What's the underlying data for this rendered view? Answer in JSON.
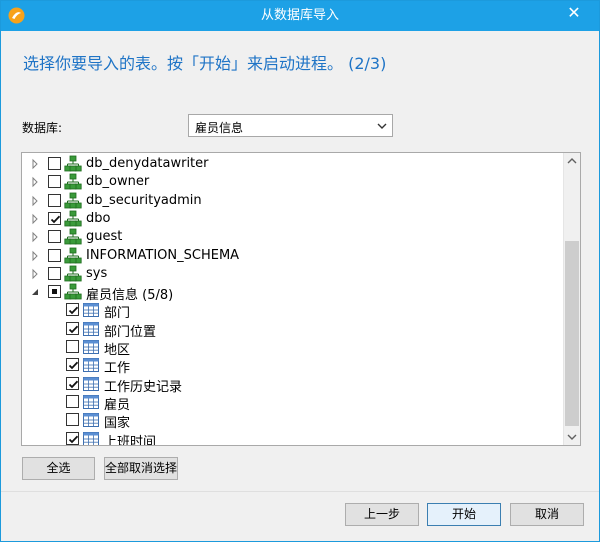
{
  "window": {
    "title": "从数据库导入",
    "accent_color": "#1da1e6",
    "close_symbol": "✕"
  },
  "heading": "选择你要导入的表。按「开始」来启动进程。 (2/3)",
  "database": {
    "label": "数据库:",
    "selected": "雇员信息"
  },
  "tree": {
    "items": [
      {
        "label": "db_denydatawriter",
        "type": "schema",
        "checked": "unchecked",
        "expander": "collapsed"
      },
      {
        "label": "db_owner",
        "type": "schema",
        "checked": "unchecked",
        "expander": "collapsed"
      },
      {
        "label": "db_securityadmin",
        "type": "schema",
        "checked": "unchecked",
        "expander": "collapsed"
      },
      {
        "label": "dbo",
        "type": "schema",
        "checked": "checked",
        "expander": "collapsed"
      },
      {
        "label": "guest",
        "type": "schema",
        "checked": "unchecked",
        "expander": "collapsed"
      },
      {
        "label": "INFORMATION_SCHEMA",
        "type": "schema",
        "checked": "unchecked",
        "expander": "collapsed"
      },
      {
        "label": "sys",
        "type": "schema",
        "checked": "unchecked",
        "expander": "collapsed"
      },
      {
        "label": "雇员信息 (5/8)",
        "type": "schema",
        "checked": "partial",
        "expander": "expanded"
      },
      {
        "label": "部门",
        "type": "table",
        "checked": "checked"
      },
      {
        "label": "部门位置",
        "type": "table",
        "checked": "checked"
      },
      {
        "label": "地区",
        "type": "table",
        "checked": "unchecked"
      },
      {
        "label": "工作",
        "type": "table",
        "checked": "checked"
      },
      {
        "label": "工作历史记录",
        "type": "table",
        "checked": "checked"
      },
      {
        "label": "雇员",
        "type": "table",
        "checked": "unchecked"
      },
      {
        "label": "国家",
        "type": "table",
        "checked": "unchecked"
      },
      {
        "label": "上班时间",
        "type": "table",
        "checked": "checked"
      }
    ]
  },
  "buttons": {
    "select_all": "全选",
    "deselect_all": "全部取消选择",
    "back": "上一步",
    "start": "开始",
    "cancel": "取消"
  }
}
